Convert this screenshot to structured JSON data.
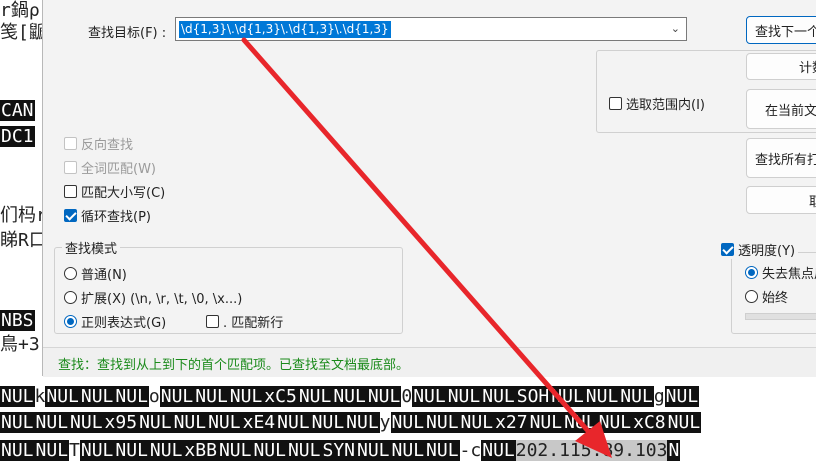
{
  "editor": {
    "left_fragments": [
      {
        "text": "r鍋ρ"
      },
      {
        "text": "笺[鼶"
      },
      {
        "text": "CAN",
        "ctrl": true
      },
      {
        "text": "DC1",
        "ctrl": true
      },
      {
        "text": "们杩r"
      },
      {
        "text": "睇R口"
      },
      {
        "text": "NBS",
        "ctrl": true
      },
      {
        "text": "鳥+3"
      }
    ],
    "rows": [
      [
        {
          "t": "NUL",
          "c": true
        },
        {
          "t": "k"
        },
        {
          "t": "NUL",
          "c": true
        },
        {
          "t": "NUL",
          "c": true
        },
        {
          "t": "NUL",
          "c": true
        },
        {
          "t": "o"
        },
        {
          "t": "NUL",
          "c": true
        },
        {
          "t": "NUL",
          "c": true
        },
        {
          "t": "NUL",
          "c": true
        },
        {
          "t": "xC5",
          "c": true
        },
        {
          "t": "NUL",
          "c": true
        },
        {
          "t": "NUL",
          "c": true
        },
        {
          "t": "NUL",
          "c": true
        },
        {
          "t": "0"
        },
        {
          "t": "NUL",
          "c": true
        },
        {
          "t": "NUL",
          "c": true
        },
        {
          "t": "NUL",
          "c": true
        },
        {
          "t": "SOH",
          "c": true
        },
        {
          "t": "NUL",
          "c": true
        },
        {
          "t": "NUL",
          "c": true
        },
        {
          "t": "NUL",
          "c": true
        },
        {
          "t": "g"
        },
        {
          "t": "NUL",
          "c": true
        }
      ],
      [
        {
          "t": "NUL",
          "c": true
        },
        {
          "t": "NUL",
          "c": true
        },
        {
          "t": "NUL",
          "c": true
        },
        {
          "t": "x95",
          "c": true
        },
        {
          "t": "NUL",
          "c": true
        },
        {
          "t": "NUL",
          "c": true
        },
        {
          "t": "NUL",
          "c": true
        },
        {
          "t": "xE4",
          "c": true
        },
        {
          "t": "NUL",
          "c": true
        },
        {
          "t": "NUL",
          "c": true
        },
        {
          "t": "NUL",
          "c": true
        },
        {
          "t": "y"
        },
        {
          "t": "NUL",
          "c": true
        },
        {
          "t": "NUL",
          "c": true
        },
        {
          "t": "NUL",
          "c": true
        },
        {
          "t": "x27",
          "c": true
        },
        {
          "t": "NUL",
          "c": true
        },
        {
          "t": "NUL",
          "c": true
        },
        {
          "t": "NUL",
          "c": true
        },
        {
          "t": "xC8",
          "c": true
        },
        {
          "t": "NUL",
          "c": true
        }
      ],
      [
        {
          "t": "NUL",
          "c": true
        },
        {
          "t": "NUL",
          "c": true
        },
        {
          "t": "T"
        },
        {
          "t": "NUL",
          "c": true
        },
        {
          "t": "NUL",
          "c": true
        },
        {
          "t": "NUL",
          "c": true
        },
        {
          "t": "xBB",
          "c": true
        },
        {
          "t": "NUL",
          "c": true
        },
        {
          "t": "NUL",
          "c": true
        },
        {
          "t": "NUL",
          "c": true
        },
        {
          "t": "SYN",
          "c": true
        },
        {
          "t": "NUL",
          "c": true
        },
        {
          "t": "NUL",
          "c": true
        },
        {
          "t": "NUL",
          "c": true
        },
        {
          "t": "-c"
        },
        {
          "t": "NUL",
          "c": true
        },
        {
          "t": "202.115.89.103",
          "match": true
        },
        {
          "t": "N",
          "c": true
        }
      ]
    ]
  },
  "dialog": {
    "find_label": "查找目标(F) :",
    "find_value": "\\d{1,3}\\.\\d{1,3}\\.\\d{1,3}\\.\\d{1,3}",
    "buttons": {
      "find_next": "查找下一个",
      "count": "计数",
      "find_in_current": "在当前文件中查找",
      "find_all_open": "查找所有打开文件",
      "cancel": "取消"
    },
    "in_selection": "选取范围内(I)",
    "options": {
      "backward": "反向查找",
      "whole_word": "全词匹配(W)",
      "match_case": "匹配大小写(C)",
      "wrap": "循环查找(P)"
    },
    "search_mode": {
      "title": "查找模式",
      "normal": "普通(N)",
      "extended": "扩展(X) (\\n, \\r, \\t, \\0, \\x...)",
      "regex": "正则表达式(G)",
      "dot_newline": ". 匹配新行"
    },
    "transparency": {
      "label": "透明度(Y)",
      "on_lose_focus": "失去焦点后",
      "always": "始终"
    },
    "status": "查找：查找到从上到下的首个匹配项。已查找至文档最底部。"
  },
  "colors": {
    "accent": "#0067c0",
    "status_text": "#1a8a1a",
    "arrow": "#e8262b"
  }
}
